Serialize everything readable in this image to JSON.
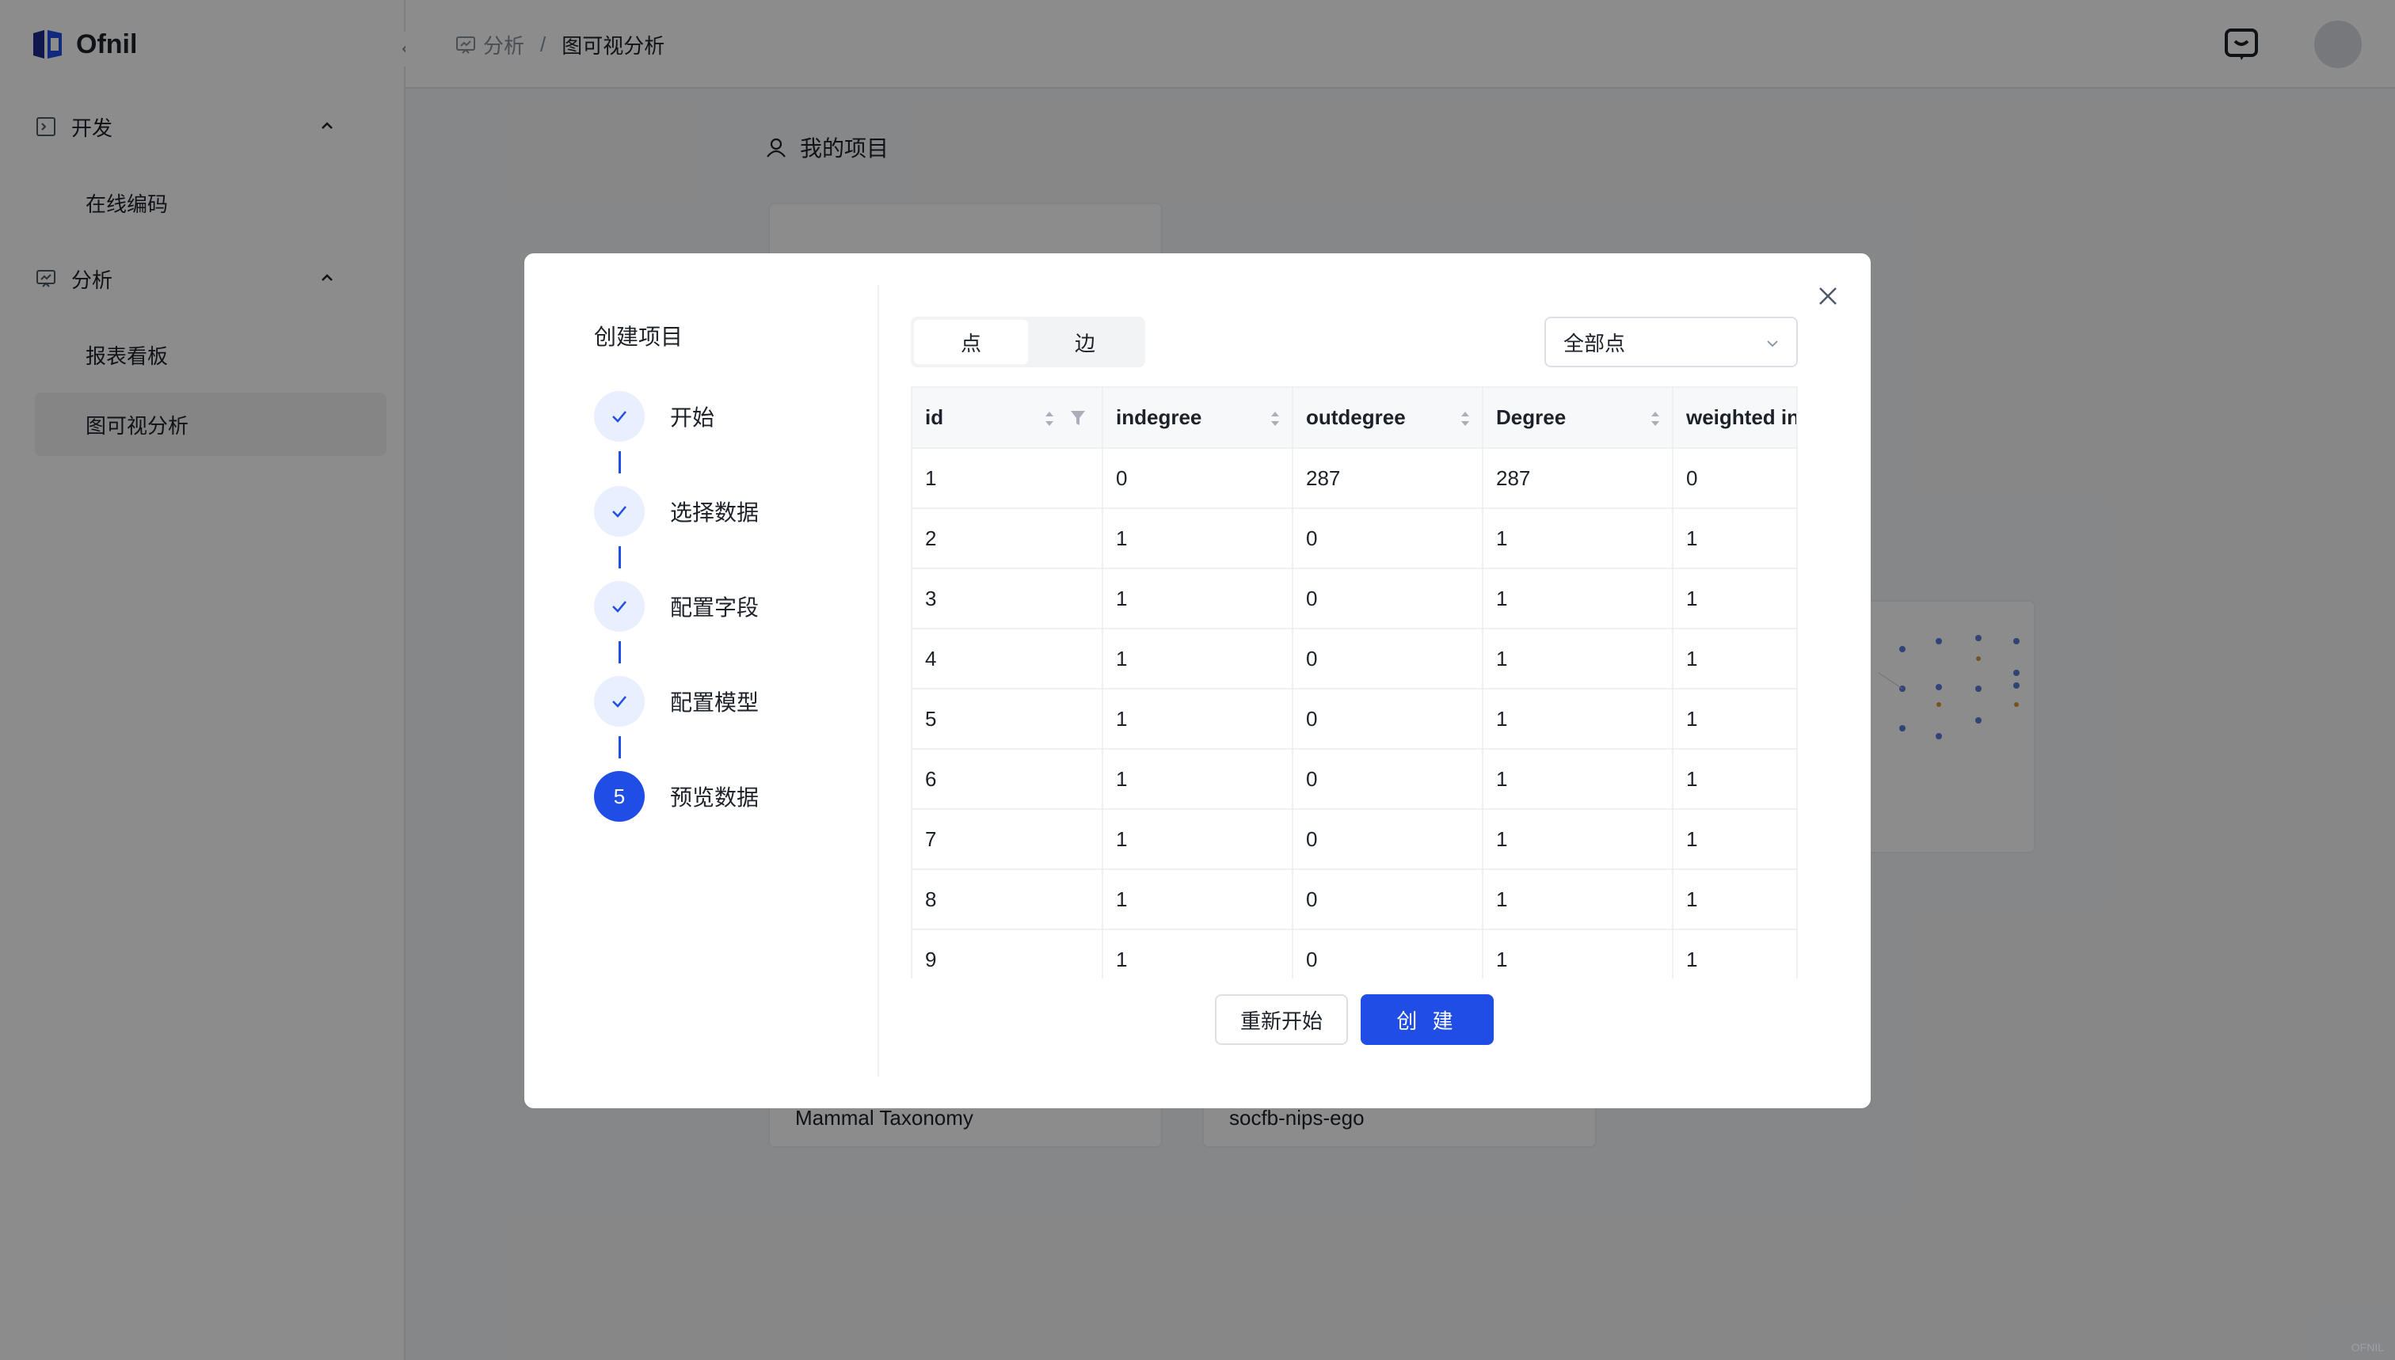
{
  "app": {
    "name": "Ofnil"
  },
  "sidebar": {
    "groups": [
      {
        "label": "开发",
        "items": [
          {
            "label": "在线编码"
          }
        ]
      },
      {
        "label": "分析",
        "items": [
          {
            "label": "报表看板"
          },
          {
            "label": "图可视分析"
          }
        ]
      }
    ]
  },
  "header": {
    "breadcrumb": {
      "parent": "分析",
      "separator": "/",
      "current": "图可视分析"
    }
  },
  "projects": {
    "title": "我的项目",
    "cards": [
      {
        "name": "Mammal Taxonomy"
      },
      {
        "name": "socfb-nips-ego"
      }
    ]
  },
  "modal": {
    "title": "创建项目",
    "steps": [
      {
        "label": "开始",
        "status": "done"
      },
      {
        "label": "选择数据",
        "status": "done"
      },
      {
        "label": "配置字段",
        "status": "done"
      },
      {
        "label": "配置模型",
        "status": "done"
      },
      {
        "label": "预览数据",
        "status": "current",
        "number": "5"
      }
    ],
    "tabs": [
      {
        "label": "点",
        "active": true
      },
      {
        "label": "边",
        "active": false
      }
    ],
    "select": {
      "value": "全部点"
    },
    "table": {
      "columns": [
        "id",
        "indegree",
        "outdegree",
        "Degree",
        "weighted in"
      ],
      "rows": [
        [
          "1",
          "0",
          "287",
          "287",
          "0"
        ],
        [
          "2",
          "1",
          "0",
          "1",
          "1"
        ],
        [
          "3",
          "1",
          "0",
          "1",
          "1"
        ],
        [
          "4",
          "1",
          "0",
          "1",
          "1"
        ],
        [
          "5",
          "1",
          "0",
          "1",
          "1"
        ],
        [
          "6",
          "1",
          "0",
          "1",
          "1"
        ],
        [
          "7",
          "1",
          "0",
          "1",
          "1"
        ],
        [
          "8",
          "1",
          "0",
          "1",
          "1"
        ],
        [
          "9",
          "1",
          "0",
          "1",
          "1"
        ]
      ]
    },
    "buttons": {
      "restart": "重新开始",
      "create": "创 建"
    }
  },
  "watermark": "OFNIL",
  "colors": {
    "primary": "#1f4de6",
    "step_done_bg": "#e8effe",
    "overlay": "rgba(0,0,0,0.45)"
  }
}
